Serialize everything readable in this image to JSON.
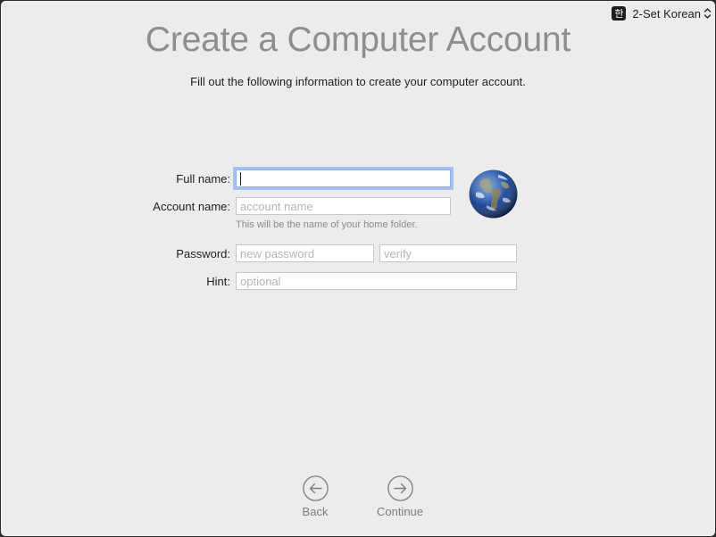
{
  "input_menu": {
    "badge": "한",
    "label": "2-Set Korean"
  },
  "header": {
    "title": "Create a Computer Account",
    "subtitle": "Fill out the following information to create your computer account."
  },
  "form": {
    "full_name": {
      "label": "Full name:",
      "value": "",
      "placeholder": ""
    },
    "account_name": {
      "label": "Account name:",
      "value": "",
      "placeholder": "account name",
      "helper": "This will be the name of your home folder."
    },
    "password": {
      "label": "Password:",
      "placeholder": "new password",
      "verify_placeholder": "verify"
    },
    "hint": {
      "label": "Hint:",
      "placeholder": "optional"
    },
    "avatar_icon": "globe-earth"
  },
  "footer": {
    "back_label": "Back",
    "continue_label": "Continue"
  },
  "colors": {
    "background": "#ececec",
    "title": "#8e8e8e",
    "focus_ring": "#a4c2f4"
  }
}
